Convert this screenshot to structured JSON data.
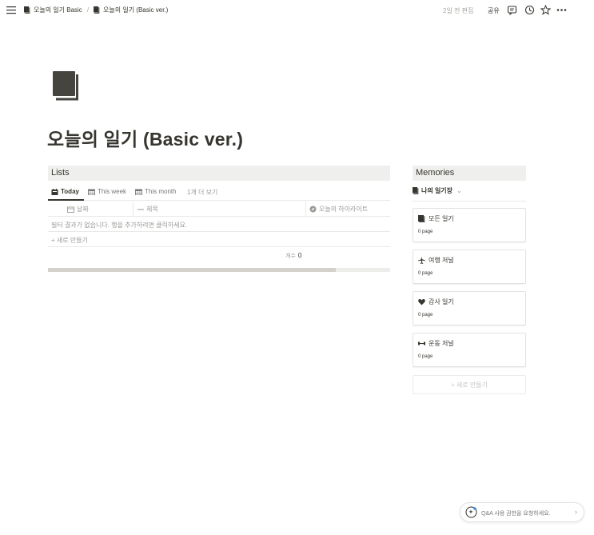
{
  "topbar": {
    "breadcrumbs": [
      "오늘의 일기 Basic",
      "오늘의 일기 (Basic ver.)"
    ],
    "separator": "/",
    "edited": "2일 전 편집",
    "share": "공유"
  },
  "page": {
    "title": "오늘의 일기 (Basic ver.)"
  },
  "lists": {
    "heading": "Lists",
    "tabs": [
      "Today",
      "This week",
      "This month"
    ],
    "more_views": "1개 더 보기",
    "columns": [
      "날짜",
      "제목",
      "오늘의 하이라이트"
    ],
    "empty_message": "필터 결과가 없습니다. 행을 추가하려면 클릭하세요.",
    "new_row": "+ 새로 만들기",
    "count_label": "개수",
    "count_value": "0",
    "scroll_fraction": 0.84
  },
  "memories": {
    "heading": "Memories",
    "view_tab": "나의 일기장",
    "view_chevron": "⌄",
    "cards": [
      {
        "title": "모든 일기",
        "count": "0 page",
        "icon": "book-icon"
      },
      {
        "title": "여행 저널",
        "count": "0 page",
        "icon": "airplane-icon"
      },
      {
        "title": "감사 일기",
        "count": "0 page",
        "icon": "heart-icon"
      },
      {
        "title": "운동 저널",
        "count": "0 page",
        "icon": "dumbbell-icon"
      }
    ],
    "new_button": "+ 새로 만들기"
  },
  "help": {
    "text": "Q&A 사용 권한을 요청하세요.",
    "chevron": "›"
  },
  "colors": {
    "text": "#37352f",
    "muted": "#9b9a97",
    "header_bg": "#efefed",
    "icon": "#37352f"
  }
}
